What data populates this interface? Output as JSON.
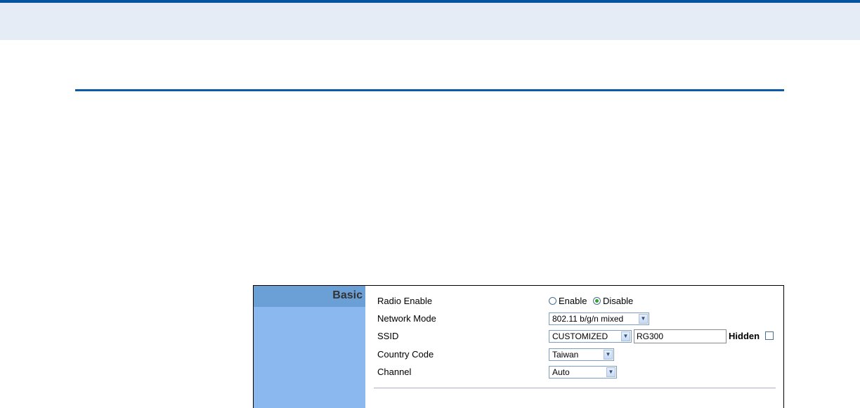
{
  "panel": {
    "section_title": "Basic",
    "radio_enable": {
      "label": "Radio Enable",
      "options": [
        {
          "label": "Enable",
          "selected": false
        },
        {
          "label": "Disable",
          "selected": true
        }
      ]
    },
    "network_mode": {
      "label": "Network Mode",
      "value": "802.11 b/g/n mixed"
    },
    "ssid": {
      "label": "SSID",
      "select_value": "CUSTOMIZED",
      "text_value": "RG300",
      "hidden_label": "Hidden",
      "hidden_checked": false
    },
    "country_code": {
      "label": "Country Code",
      "value": "Taiwan"
    },
    "channel": {
      "label": "Channel",
      "value": "Auto"
    }
  },
  "colors": {
    "header_band": "#e5ecf6",
    "header_border": "#08539e",
    "sidebar": "#8ab8ef",
    "sidebar_header": "#6aa0d6",
    "radio_selected": "#2ea32e"
  }
}
